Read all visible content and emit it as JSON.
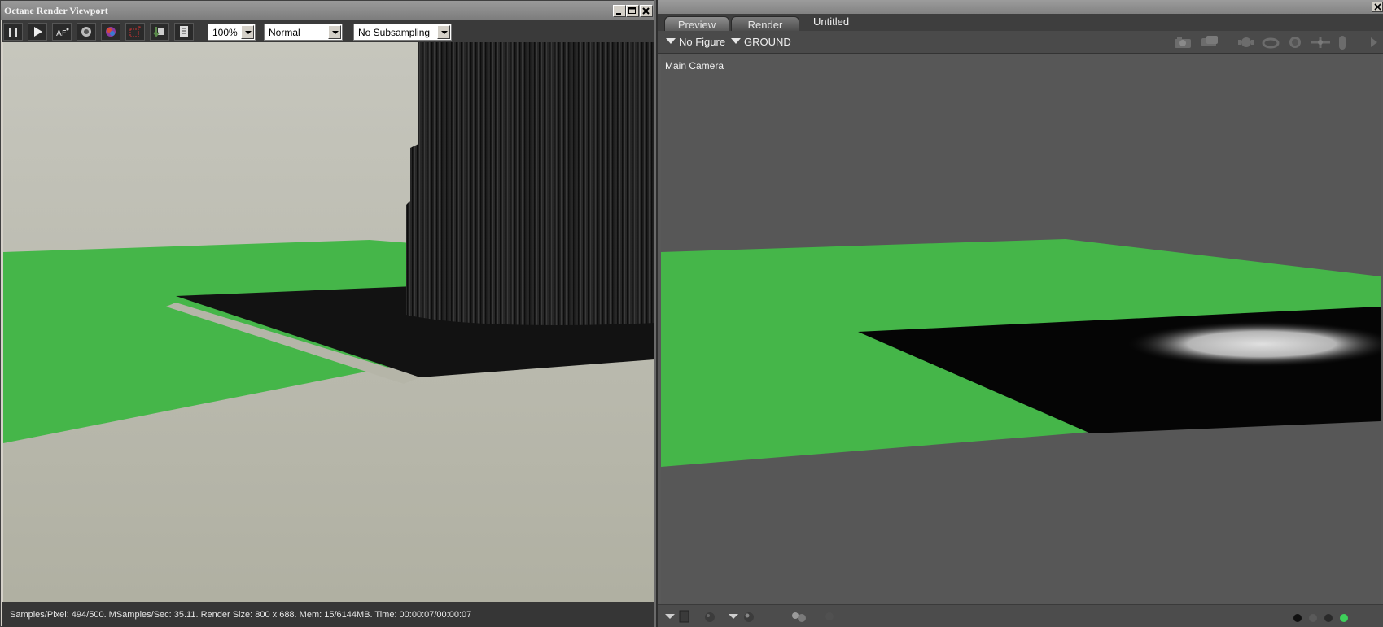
{
  "octane": {
    "title": "Octane Render Viewport",
    "toolbar": {
      "pause_icon": "pause-icon",
      "play_icon": "play-icon",
      "icons": [
        "af-icon",
        "reload-icon",
        "color-wheel-icon",
        "region-icon",
        "export-icon",
        "document-icon"
      ],
      "zoom": {
        "value": "100%"
      },
      "mode": {
        "value": "Normal"
      },
      "subsampling": {
        "value": "No Subsampling"
      }
    },
    "status": "Samples/Pixel: 494/500. MSamples/Sec: 35.11. Render Size: 800 x 688. Mem: 15/6144MB. Time: 00:00:07/00:00:07"
  },
  "poser": {
    "tabs": [
      {
        "label": "Preview",
        "active": true
      },
      {
        "label": "Render",
        "active": false
      }
    ],
    "document_title": "Untitled",
    "figure_menu": "No Figure",
    "actor_menu": "GROUND",
    "camera_label": "Main Camera",
    "camera_icons": [
      "camera-icon",
      "camera-dolly-icon",
      "face-camera-icon",
      "rotate-icon",
      "trackball-icon",
      "move-xy-icon",
      "move-z-icon",
      "scroll-right-icon"
    ],
    "bottom_icons": [
      "menu-arrow-icon",
      "display-style-icon",
      "sphere-icon",
      "menu-arrow-icon",
      "sphere-lit-icon",
      "multi-sphere-icon",
      "disabled-dot-icon"
    ],
    "indicator_colors": [
      "#111111",
      "#5a5a5a",
      "#2a2a2a",
      "#3ed05a"
    ]
  },
  "colors": {
    "green_floor": "#45b649",
    "dark_plane": "#111111",
    "backdrop": "#b7b7ab"
  }
}
